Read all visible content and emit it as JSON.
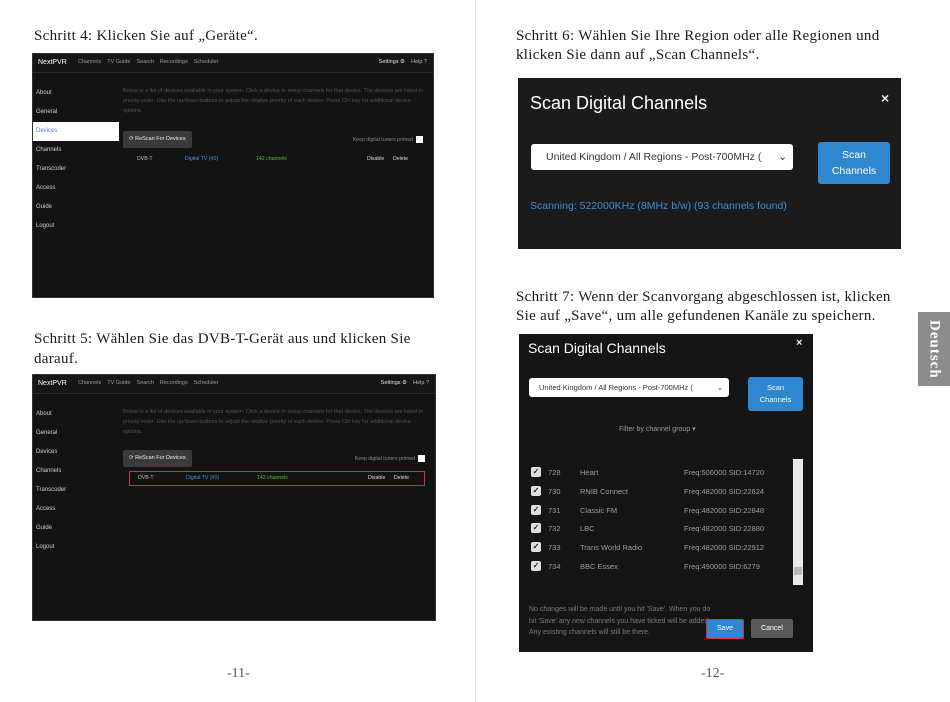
{
  "left_page": {
    "step4": "Schritt 4: Klicken Sie auf „Geräte“.",
    "step5_line1": "Schritt 5: Wählen Sie das DVB-T-Gerät aus und klicken Sie",
    "step5_line2": "darauf.",
    "page_number": "-11-"
  },
  "right_page": {
    "step6_line1": "Schritt 6: Wählen Sie Ihre Region oder alle Regionen und",
    "step6_line2": "klicken Sie dann auf „Scan Channels“.",
    "step7_line1": "Schritt 7: Wenn der Scanvorgang abgeschlossen ist, klicken",
    "step7_line2": "Sie auf „Save“, um alle gefundenen Kanäle zu speichern.",
    "page_number": "-12-",
    "side_tab": "Deutsch"
  },
  "nextpvr": {
    "brand": "NextPVR",
    "menu": [
      "Channels",
      "TV Guide",
      "Search",
      "Recordings",
      "Scheduler"
    ],
    "settings": "Settings ⚙",
    "help": "Help ?",
    "sidebar": [
      "About",
      "General",
      "Devices",
      "Channels",
      "Transcoder",
      "Access",
      "Guide",
      "Logout"
    ],
    "description": "Below is a list of devices available in your system. Click a device to setup channels for that device. The devices are listed in priority order. Use the up/down buttons to adjust the relative priority of each device. Press Ctrl key for additional device options.",
    "rescan": "⟳ ReScan For Devices",
    "keep_tuners": "Keep digital tuners primed",
    "device": {
      "name": "DVB-T",
      "type": "Digital TV (#0)",
      "channels": "142 channels",
      "disable": "Disable",
      "delete": "Delete"
    }
  },
  "scan_dialog": {
    "title": "Scan Digital Channels",
    "close": "×",
    "region": "United Kingdom / All Regions - Post-700MHz (",
    "scan_button_line1": "Scan",
    "scan_button_line2": "Channels",
    "status": "Scanning: 522000KHz (8MHz b/w) (93 channels found)"
  },
  "save_dialog": {
    "filter": "Filter by channel group ▾",
    "channels": [
      {
        "num": "728",
        "name": "Heart",
        "freq": "Freq:506000 SID:14720"
      },
      {
        "num": "730",
        "name": "RNIB Connect",
        "freq": "Freq:482000 SID:22624"
      },
      {
        "num": "731",
        "name": "Classic FM",
        "freq": "Freq:482000 SID:22848"
      },
      {
        "num": "732",
        "name": "LBC",
        "freq": "Freq:482000 SID:22880"
      },
      {
        "num": "733",
        "name": "Trans World Radio",
        "freq": "Freq:482000 SID:22912"
      },
      {
        "num": "734",
        "name": "BBC Essex",
        "freq": "Freq:490000 SID:6279"
      }
    ],
    "note": "No changes will be made until you hit 'Save'. When you do hit 'Save' any new channels you have ticked will be added. Any existing channels will still be there.",
    "save": "Save",
    "cancel": "Cancel"
  }
}
